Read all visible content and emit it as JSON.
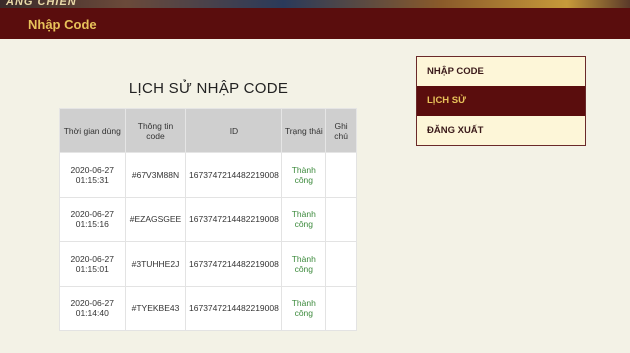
{
  "header": {
    "banner_text": "ÂNG CHIẾN",
    "title": "Nhập Code"
  },
  "history": {
    "title": "LỊCH SỬ NHẬP CODE",
    "columns": [
      "Thời gian dùng",
      "Thông tin code",
      "ID",
      "Trạng thái",
      "Ghi chú"
    ],
    "rows": [
      {
        "time_date": "2020-06-27",
        "time_clock": "01:15:31",
        "code": "#67V3M88N",
        "id": "1673747214482219008",
        "status": "Thành công",
        "note": ""
      },
      {
        "time_date": "2020-06-27",
        "time_clock": "01:15:16",
        "code": "#EZAGSGEE",
        "id": "1673747214482219008",
        "status": "Thành công",
        "note": ""
      },
      {
        "time_date": "2020-06-27",
        "time_clock": "01:15:01",
        "code": "#3TUHHE2J",
        "id": "1673747214482219008",
        "status": "Thành công",
        "note": ""
      },
      {
        "time_date": "2020-06-27",
        "time_clock": "01:14:40",
        "code": "#TYEKBE43",
        "id": "1673747214482219008",
        "status": "Thành công",
        "note": ""
      }
    ]
  },
  "menu": {
    "items": [
      {
        "label": "NHẬP CODE",
        "active": false
      },
      {
        "label": "LỊCH SỬ",
        "active": true
      },
      {
        "label": "ĐĂNG XUẤT",
        "active": false
      }
    ]
  },
  "colors": {
    "header_bg": "#5a0d0d",
    "accent_gold": "#e8c25a",
    "success_green": "#3c8a3c",
    "page_bg": "#f3f2e6"
  }
}
